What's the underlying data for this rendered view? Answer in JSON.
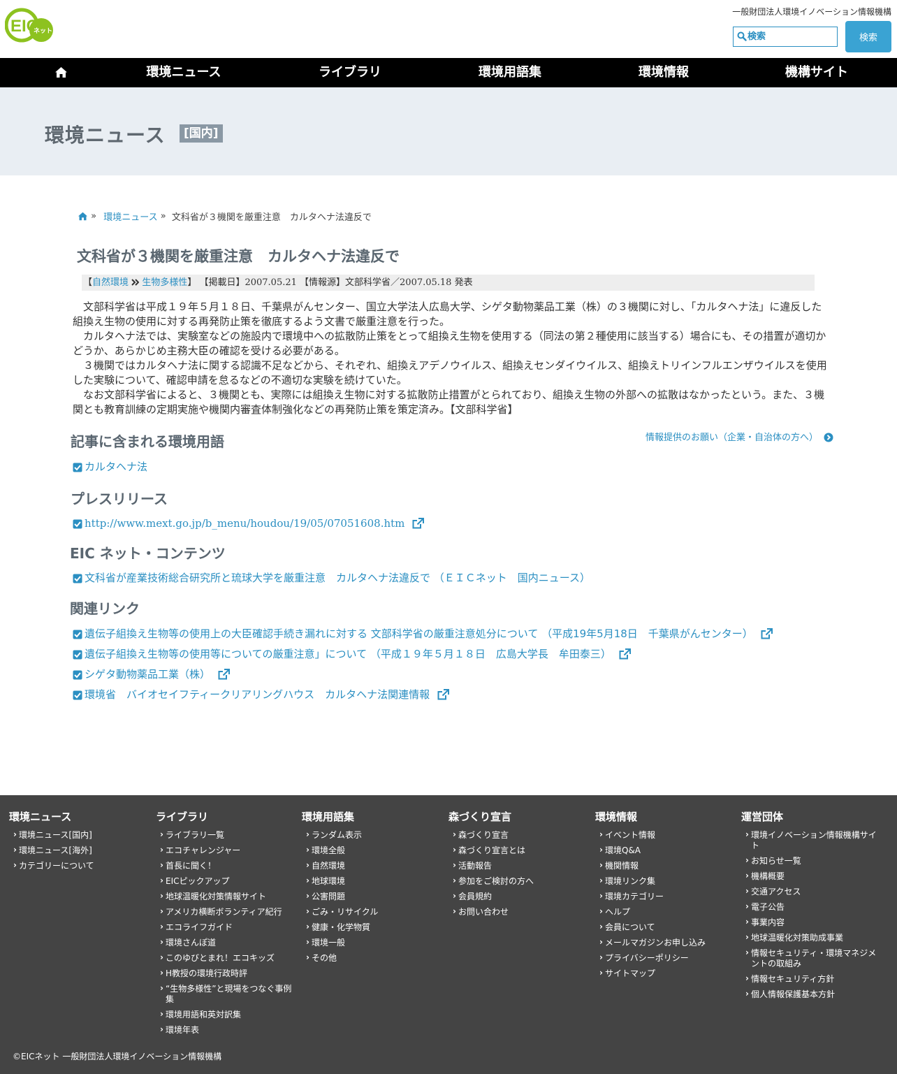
{
  "header": {
    "logo_text": "EIC",
    "logo_sub": "ネット",
    "org_name": "一般財団法人環境イノベーション情報機構",
    "search_placeholder": "検索",
    "search_button": "検索"
  },
  "nav": {
    "items": [
      "環境ニュース",
      "ライブラリ",
      "環境用語集",
      "環境情報",
      "機構サイト"
    ]
  },
  "banner": {
    "title": "環境ニュース",
    "tag": "[国内]"
  },
  "breadcrumb": {
    "sep": "»",
    "item1": "環境ニュース",
    "current": "文科省が３機関を厳重注意　カルタヘナ法違反で"
  },
  "article": {
    "title": "文科省が３機関を厳重注意　カルタヘナ法違反で",
    "meta": {
      "open": "【",
      "cat1": "自然環境",
      "cat2": "生物多様性",
      "rest": "】 【掲載日】2007.05.21 【情報源】文部科学省／2007.05.18 発表"
    },
    "paragraphs": [
      "文部科学省は平成１９年５月１８日、千葉県がんセンター、国立大学法人広島大学、シゲタ動物薬品工業（株）の３機関に対し、「カルタヘナ法」に違反した組換え生物の使用に対する再発防止策を徹底するよう文書で厳重注意を行った。",
      "カルタヘナ法では、実験室などの施設内で環境中への拡散防止策をとって組換え生物を使用する（同法の第２種使用に該当する）場合にも、その措置が適切かどうか、あらかじめ主務大臣の確認を受ける必要がある。",
      "３機関ではカルタヘナ法に関する認識不足などから、それぞれ、組換えアデノウイルス、組換えセンダイウイルス、組換えトリインフルエンザウイルスを使用した実験について、確認申請を怠るなどの不適切な実験を続けていた。",
      "なお文部科学省によると、３機関とも、実際には組換え生物に対する拡散防止措置がとられており、組換え生物の外部への拡散はなかったという。また、３機関とも教育訓練の定期実施や機関内審査体制強化などの再発防止策を策定済み。【文部科学省】"
    ]
  },
  "sections": {
    "terms_heading": "記事に含まれる環境用語",
    "request_link": "情報提供のお願い（企業・自治体の方へ）",
    "terms": [
      "カルタヘナ法"
    ],
    "press_heading": "プレスリリース",
    "press": [
      "http://www.mext.go.jp/b_menu/houdou/19/05/07051608.htm"
    ],
    "contents_heading": "EIC ネット・コンテンツ",
    "contents": [
      "文科省が産業技術総合研究所と琉球大学を厳重注意　カルタヘナ法違反で （ＥＩＣネット　国内ニュース）"
    ],
    "related_heading": "関連リンク",
    "related": [
      "遺伝子組換え生物等の使用上の大臣確認手続き漏れに対する 文部科学省の厳重注意処分について （平成19年5月18日　千葉県がんセンター）",
      "遺伝子組換え生物等の使用等についての厳重注意」について （平成１９年５月１８日　広島大学長　牟田泰三）",
      "シゲタ動物薬品工業（株）",
      "環境省　バイオセイフティークリアリングハウス　カルタヘナ法関連情報"
    ]
  },
  "footer": {
    "columns": [
      {
        "title": "環境ニュース",
        "items": [
          "環境ニュース[国内]",
          "環境ニュース[海外]",
          "カテゴリーについて"
        ]
      },
      {
        "title": "ライブラリ",
        "items": [
          "ライブラリ一覧",
          "エコチャレンジャー",
          "首長に聞く！",
          "EICピックアップ",
          "地球温暖化対策情報サイト",
          "アメリカ横断ボランティア紀行",
          "エコライフガイド",
          "環境さんぽ道",
          "このゆびとまれ！エコキッズ",
          "H教授の環境行政時評",
          "“生物多様性”と現場をつなぐ事例集",
          "環境用語和英対訳集",
          "環境年表"
        ]
      },
      {
        "title": "環境用語集",
        "items": [
          "ランダム表示",
          "環境全般",
          "自然環境",
          "地球環境",
          "公害問題",
          "ごみ・リサイクル",
          "健康・化学物質",
          "環境一般",
          "その他"
        ]
      },
      {
        "title": "森づくり宣言",
        "items": [
          "森づくり宣言",
          "森づくり宣言とは",
          "活動報告",
          "参加をご検討の方へ",
          "会員規約",
          "お問い合わせ"
        ]
      },
      {
        "title": "環境情報",
        "items": [
          "イベント情報",
          "環境Q&A",
          "機関情報",
          "環境リンク集",
          "環境カテゴリー",
          "ヘルプ",
          "会員について",
          "メールマガジンお申し込み",
          "プライバシーポリシー",
          "サイトマップ"
        ]
      },
      {
        "title": "運営団体",
        "items": [
          "環境イノベーション情報機構サイト",
          "お知らせ一覧",
          "機構概要",
          "交通アクセス",
          "電子公告",
          "事業内容",
          "地球温暖化対策助成事業",
          "情報セキュリティ・環境マネジメントの取組み",
          "情報セキュリティ方針",
          "個人情報保護基本方針"
        ]
      }
    ],
    "copyright": "©EICネット 一般財団法人環境イノベーション情報機構"
  }
}
